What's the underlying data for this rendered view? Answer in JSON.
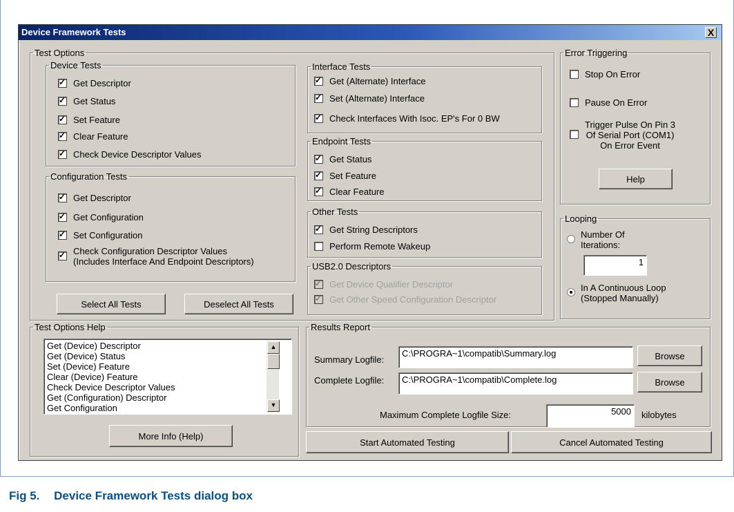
{
  "window": {
    "title": "Device Framework Tests",
    "close_label": "X"
  },
  "test_options": {
    "legend": "Test Options",
    "device_tests": {
      "legend": "Device Tests",
      "items": [
        "Get Descriptor",
        "Get Status",
        "Set Feature",
        "Clear Feature",
        "Check Device Descriptor Values"
      ]
    },
    "configuration_tests": {
      "legend": "Configuration Tests",
      "items": [
        "Get Descriptor",
        "Get Configuration",
        "Set Configuration"
      ],
      "check_values_line1": "Check Configuration Descriptor Values",
      "check_values_line2": "(Includes Interface And Endpoint Descriptors)"
    },
    "interface_tests": {
      "legend": "Interface Tests",
      "items": [
        "Get (Alternate) Interface",
        "Set (Alternate) Interface",
        "Check Interfaces With Isoc. EP's For 0 BW"
      ]
    },
    "endpoint_tests": {
      "legend": "Endpoint Tests",
      "items": [
        "Get Status",
        "Set Feature",
        "Clear Feature"
      ]
    },
    "other_tests": {
      "legend": "Other Tests",
      "items": [
        "Get String Descriptors",
        "Perform Remote Wakeup"
      ]
    },
    "usb2_descriptors": {
      "legend": "USB2.0 Descriptors",
      "items": [
        "Get Device Qualifier Descriptor",
        "Get Other Speed Configuration Descriptor"
      ]
    },
    "select_all_label": "Select All Tests",
    "deselect_all_label": "Deselect All Tests"
  },
  "error_triggering": {
    "legend": "Error Triggering",
    "stop_on_error": "Stop On Error",
    "pause_on_error": "Pause On Error",
    "trigger_line1": "Trigger Pulse On Pin 3",
    "trigger_line2": "Of Serial Port (COM1)",
    "trigger_line3": "On Error Event",
    "help_label": "Help"
  },
  "looping": {
    "legend": "Looping",
    "number_line1": "Number Of",
    "number_line2": "Iterations:",
    "iterations_value": "1",
    "continuous_line1": "In A Continuous Loop",
    "continuous_line2": "(Stopped Manually)"
  },
  "help_box": {
    "legend": "Test Options Help",
    "lines": [
      "Get (Device) Descriptor",
      "Get (Device) Status",
      "Set (Device) Feature",
      "Clear (Device) Feature",
      "Check Device Descriptor Values",
      "Get (Configuration) Descriptor",
      "Get Configuration"
    ],
    "more_info_label": "More Info (Help)"
  },
  "results": {
    "legend": "Results Report",
    "summary_label": "Summary Logfile:",
    "summary_value": "C:\\PROGRA~1\\compatib\\Summary.log",
    "complete_label": "Complete Logfile:",
    "complete_value": "C:\\PROGRA~1\\compatib\\Complete.log",
    "browse_label": "Browse",
    "max_size_label": "Maximum Complete Logfile Size:",
    "max_size_value": "5000",
    "max_size_unit": "kilobytes"
  },
  "actions": {
    "start_label": "Start Automated Testing",
    "cancel_label": "Cancel Automated Testing"
  },
  "caption": {
    "number": "Fig 5.",
    "text": "Device Framework Tests dialog box"
  },
  "colors": {
    "titlebar": "#0a246a",
    "dialog_face": "#d4d0c8",
    "caption": "#0c4f7e"
  }
}
